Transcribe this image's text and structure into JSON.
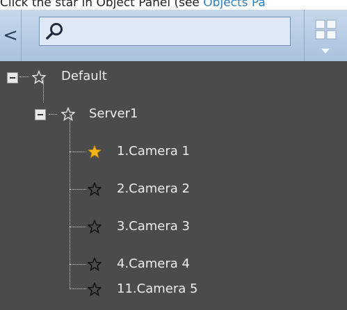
{
  "caption": {
    "text": "Click the star in Object Panel (see ",
    "link": "Objects Pa"
  },
  "toolbar": {
    "back_glyph": "<",
    "search_value": "",
    "search_placeholder": ""
  },
  "tree": {
    "nodes": [
      {
        "label": "Default",
        "favorite": false
      },
      {
        "label": "Server1",
        "favorite": false
      },
      {
        "label": "1.Camera 1",
        "favorite": true
      },
      {
        "label": "2.Camera 2",
        "favorite": false
      },
      {
        "label": "3.Camera 3",
        "favorite": false
      },
      {
        "label": "4.Camera 4",
        "favorite": false
      },
      {
        "label": "11.Camera 5",
        "favorite": false
      }
    ]
  },
  "colors": {
    "tree_background": "#4b4b4b",
    "favorite_star": "#f2b51c",
    "link": "#2f7fc1"
  }
}
